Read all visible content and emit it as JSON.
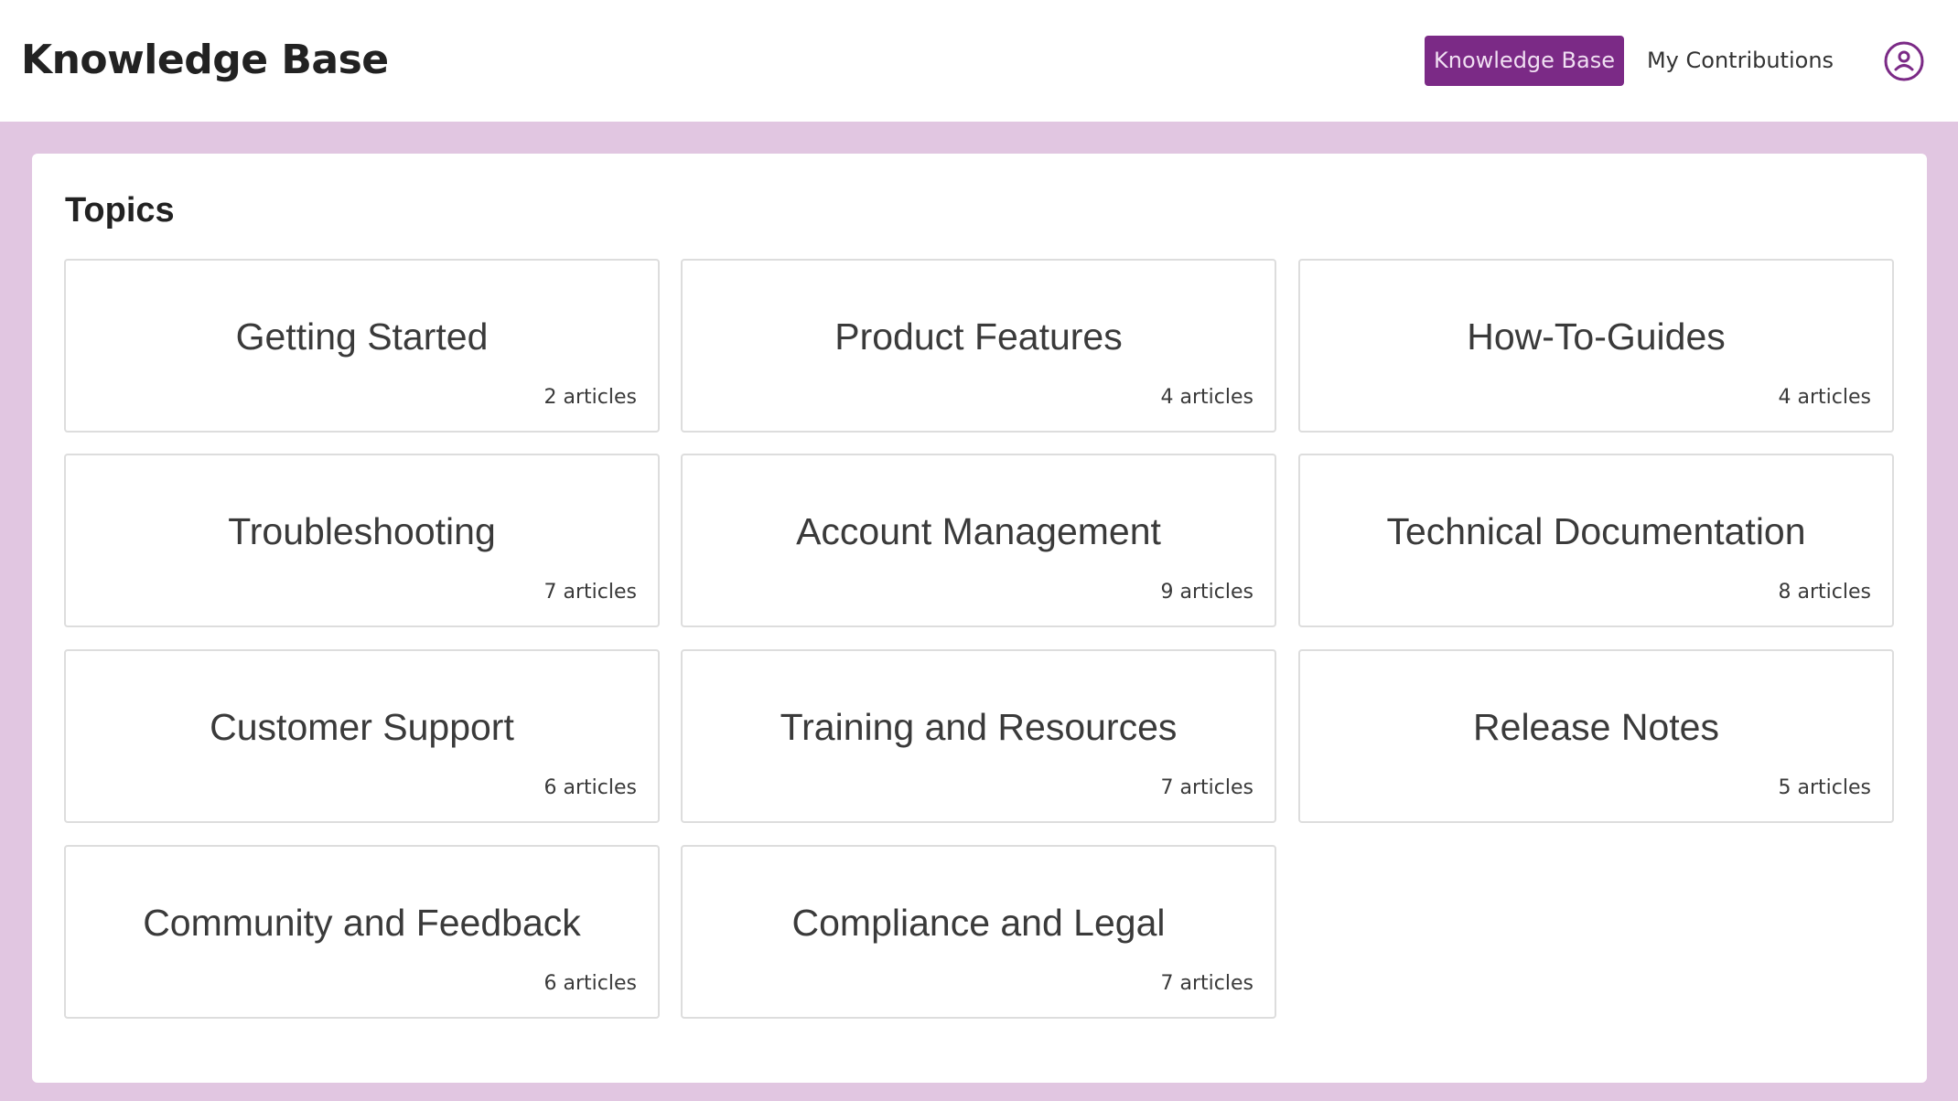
{
  "header": {
    "title": "Knowledge Base",
    "nav": [
      {
        "label": "Knowledge Base",
        "active": true
      },
      {
        "label": "My Contributions",
        "active": false
      }
    ],
    "user_icon": "user-circle-icon"
  },
  "colors": {
    "accent": "#7b2a86",
    "page_background": "#e1c6e1"
  },
  "main": {
    "section_title": "Topics",
    "topics": [
      {
        "name": "Getting Started",
        "count": "2 articles"
      },
      {
        "name": "Product Features",
        "count": "4 articles"
      },
      {
        "name": "How-To-Guides",
        "count": "4 articles"
      },
      {
        "name": "Troubleshooting",
        "count": "7 articles"
      },
      {
        "name": "Account Management",
        "count": "9 articles"
      },
      {
        "name": "Technical Documentation",
        "count": "8 articles"
      },
      {
        "name": "Customer Support",
        "count": "6 articles"
      },
      {
        "name": "Training and Resources",
        "count": "7 articles"
      },
      {
        "name": "Release Notes",
        "count": "5 articles"
      },
      {
        "name": "Community and Feedback",
        "count": "6 articles"
      },
      {
        "name": "Compliance and Legal",
        "count": "7 articles"
      }
    ]
  }
}
